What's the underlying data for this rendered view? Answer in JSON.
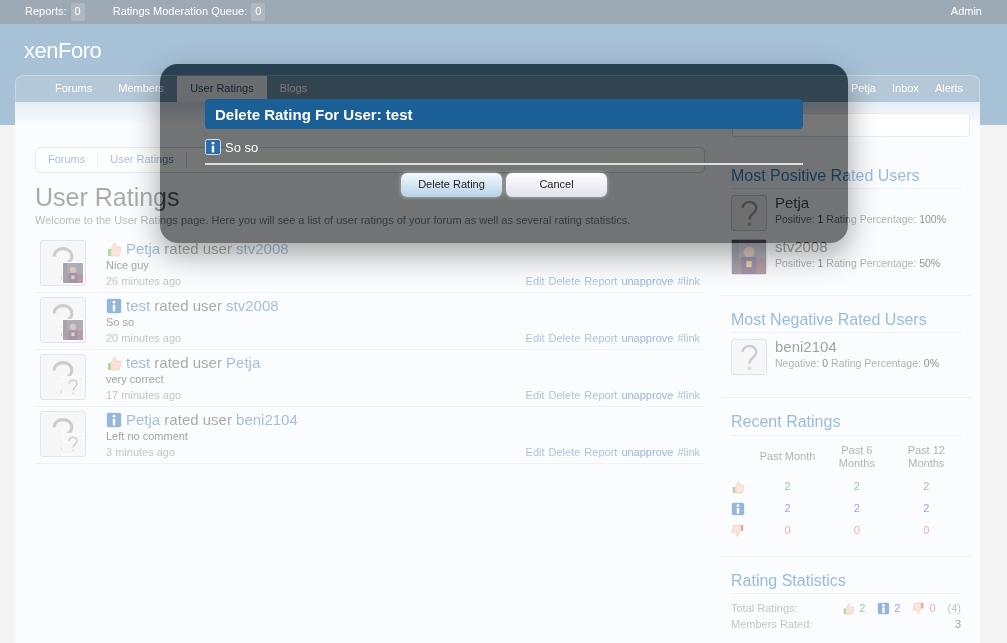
{
  "top_bar": {
    "reports_label": "Reports:",
    "reports_count": "0",
    "queue_label": "Ratings Moderation Queue:",
    "queue_count": "0",
    "user": "Admin"
  },
  "logo": "xenForo",
  "nav": {
    "tabs": [
      {
        "label": "Forums",
        "selected": false
      },
      {
        "label": "Members",
        "selected": false
      },
      {
        "label": "User Ratings",
        "selected": true
      },
      {
        "label": "Blogs",
        "selected": false
      }
    ],
    "right": [
      "Petja",
      "Inbox",
      "Alerts"
    ]
  },
  "breadcrumb": [
    "Forums",
    "User Ratings"
  ],
  "page_title": "User Ratings",
  "description": "Welcome to the User Ratings page. Here you will see a list of user ratings of your forum as well as several rating statistics.",
  "ratings": [
    {
      "kind": "positive",
      "rater": "Petja",
      "verb": "rated user",
      "ratee": "stv2008",
      "comment": "Nice guy",
      "time": "26 minutes ago",
      "actions": [
        "Edit",
        "Delete",
        "Report",
        "unapprove",
        "#link"
      ]
    },
    {
      "kind": "neutral",
      "rater": "test",
      "verb": "rated user",
      "ratee": "stv2008",
      "comment": "So so",
      "time": "20 minutes ago",
      "actions": [
        "Edit",
        "Delete",
        "Report",
        "unapprove",
        "#link"
      ]
    },
    {
      "kind": "positive",
      "rater": "test",
      "verb": "rated user",
      "ratee": "Petja",
      "comment": "very correct",
      "time": "17 minutes ago",
      "ratee_avatar": {
        "kind": "placeholder"
      },
      "actions": [
        "Edit",
        "Delete",
        "Report",
        "unapprove",
        "#link"
      ]
    },
    {
      "kind": "neutral",
      "rater": "Petja",
      "verb": "rated user",
      "ratee": "beni2104",
      "comment": "Left no comment",
      "time": "3 minutes ago",
      "ratee_avatar": {
        "kind": "placeholder"
      },
      "actions": [
        "Edit",
        "Delete",
        "Report",
        "unapprove",
        "#link"
      ]
    }
  ],
  "sidebar": {
    "most_positive": {
      "title": "Most Positive Rated Users",
      "users": [
        {
          "name": "Petja",
          "count_label": "Positive:",
          "count": "1",
          "pct_label": "Rating Percentage:",
          "pct": "100%",
          "avatar": {
            "kind": "placeholder"
          }
        },
        {
          "name": "stv2008",
          "count_label": "Positive:",
          "count": "1",
          "pct_label": "Rating Percentage:",
          "pct": "50%"
        }
      ]
    },
    "most_negative": {
      "title": "Most Negative Rated Users",
      "users": [
        {
          "name": "beni2104",
          "count_label": "Negative:",
          "count": "0",
          "pct_label": "Rating Percentage:",
          "pct": "0%",
          "avatar": {
            "kind": "placeholder"
          }
        }
      ]
    },
    "recent": {
      "title": "Recent Ratings",
      "columns": [
        "Past Month",
        "Past 6 Months",
        "Past 12 Months"
      ],
      "rows": [
        {
          "kind": "positive",
          "values": [
            "2",
            "2",
            "2"
          ]
        },
        {
          "kind": "neutral",
          "values": [
            "2",
            "2",
            "2"
          ]
        },
        {
          "kind": "negative",
          "values": [
            "0",
            "0",
            "0"
          ]
        }
      ]
    },
    "statistics": {
      "title": "Rating Statistics",
      "total_label": "Total Ratings:",
      "totals": [
        {
          "kind": "positive",
          "value": "2"
        },
        {
          "kind": "neutral",
          "value": "2"
        },
        {
          "kind": "negative",
          "value": "0"
        }
      ],
      "total_all": "(4)",
      "rows": [
        {
          "label": "Members Rated:",
          "value": "3"
        }
      ]
    }
  },
  "dialog": {
    "title": "Delete Rating For User: test",
    "kind": "neutral",
    "message": "So so",
    "buttons": [
      "Delete Rating",
      "Cancel"
    ]
  }
}
